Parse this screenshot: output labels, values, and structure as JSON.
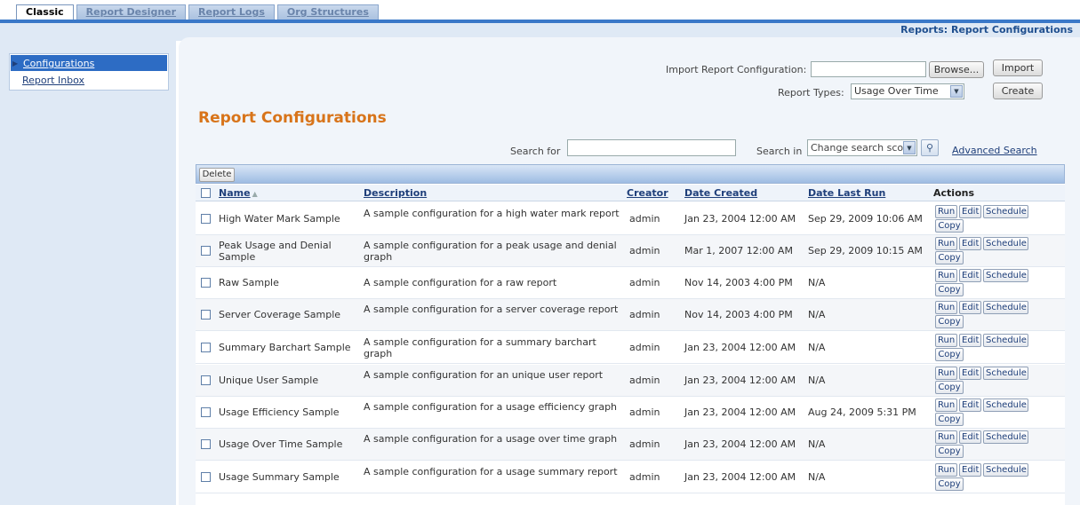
{
  "tabs": [
    {
      "label": "Classic"
    },
    {
      "label": "Report Designer"
    },
    {
      "label": "Report Logs"
    },
    {
      "label": "Org Structures"
    }
  ],
  "breadcrumb": "Reports: Report Configurations",
  "sidebar": {
    "items": [
      {
        "label": "Configurations"
      },
      {
        "label": "Report Inbox"
      }
    ]
  },
  "import": {
    "label": "Import Report Configuration:",
    "value": "",
    "browse_label": "Browse...",
    "import_label": "Import"
  },
  "report_types": {
    "label": "Report Types:",
    "selected": "Usage Over Time",
    "create_label": "Create"
  },
  "page_title": "Report Configurations",
  "search": {
    "label": "Search for",
    "value": "",
    "scope_label": "Search in",
    "scope_selected": "Change search scope",
    "advanced_label": "Advanced Search"
  },
  "grid": {
    "delete_label": "Delete",
    "columns": {
      "name": "Name",
      "description": "Description",
      "creator": "Creator",
      "date_created": "Date Created",
      "date_last_run": "Date Last Run",
      "actions": "Actions"
    },
    "action_labels": {
      "run": "Run",
      "edit": "Edit",
      "schedule": "Schedule",
      "copy": "Copy"
    },
    "rows": [
      {
        "name": "High Water Mark Sample",
        "description": "A sample configuration for a high water mark report",
        "creator": "admin",
        "date_created": "Jan 23, 2004 12:00 AM",
        "date_last_run": "Sep 29, 2009 10:06 AM"
      },
      {
        "name": "Peak Usage and Denial Sample",
        "description": "A sample configuration for a peak usage and denial graph",
        "creator": "admin",
        "date_created": "Mar 1, 2007 12:00 AM",
        "date_last_run": "Sep 29, 2009 10:15 AM"
      },
      {
        "name": "Raw Sample",
        "description": "A sample configuration for a raw report",
        "creator": "admin",
        "date_created": "Nov 14, 2003 4:00 PM",
        "date_last_run": "N/A"
      },
      {
        "name": "Server Coverage Sample",
        "description": "A sample configuration for a server coverage report",
        "creator": "admin",
        "date_created": "Nov 14, 2003 4:00 PM",
        "date_last_run": "N/A"
      },
      {
        "name": "Summary Barchart Sample",
        "description": "A sample configuration for a summary barchart graph",
        "creator": "admin",
        "date_created": "Jan 23, 2004 12:00 AM",
        "date_last_run": "N/A"
      },
      {
        "name": "Unique User Sample",
        "description": "A sample configuration for an unique user report",
        "creator": "admin",
        "date_created": "Jan 23, 2004 12:00 AM",
        "date_last_run": "N/A"
      },
      {
        "name": "Usage Efficiency Sample",
        "description": "A sample configuration for a usage efficiency graph",
        "creator": "admin",
        "date_created": "Jan 23, 2004 12:00 AM",
        "date_last_run": "Aug 24, 2009 5:31 PM"
      },
      {
        "name": "Usage Over Time Sample",
        "description": "A sample configuration for a usage over time graph",
        "creator": "admin",
        "date_created": "Jan 23, 2004 12:00 AM",
        "date_last_run": "N/A"
      },
      {
        "name": "Usage Summary Sample",
        "description": "A sample configuration for a usage summary report",
        "creator": "admin",
        "date_created": "Jan 23, 2004 12:00 AM",
        "date_last_run": "N/A"
      }
    ]
  },
  "colors": {
    "accent_blue": "#3a78c8",
    "title_orange": "#d8741a",
    "panel_bg": "#dfe9f5",
    "link_blue": "#1f3f7a"
  }
}
